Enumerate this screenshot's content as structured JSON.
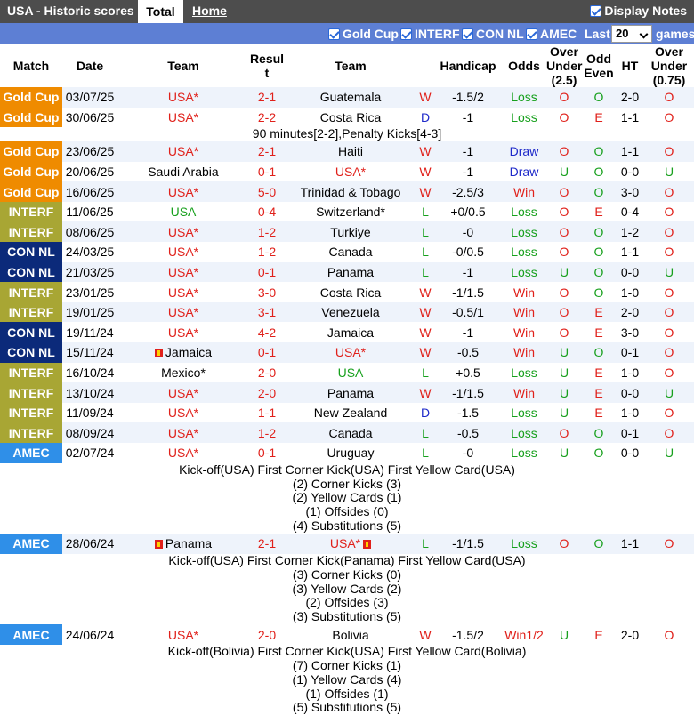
{
  "header": {
    "title": "USA - Historic scores",
    "tab_total": "Total",
    "tab_home": "Home",
    "display_notes": "Display Notes"
  },
  "filters": {
    "gold_cup": "Gold Cup",
    "interf": "INTERF",
    "con_nl": "CON NL",
    "amec": "AMEC",
    "last_label": "Last",
    "last_value": "20",
    "games_label": "games"
  },
  "columns": {
    "match": "Match",
    "date": "Date",
    "team": "Team",
    "result": "Resul t",
    "team2": "Team",
    "handicap": "Handicap",
    "odds": "Odds",
    "over_under": "Over Under (2.5)",
    "odd_even": "Odd Even",
    "ht": "HT",
    "over_under2": "Over Under (0.75)"
  },
  "rows": [
    {
      "comp": "Gold Cup",
      "date": "03/07/25",
      "home": "USA*",
      "score": "2-1",
      "away": "Guatemala",
      "res": "W",
      "hcp": "-1.5/2",
      "odds": "Loss",
      "ou": "O",
      "oe": "O",
      "ht": "2-0",
      "ou2": "O"
    },
    {
      "comp": "Gold Cup",
      "date": "30/06/25",
      "home": "USA*",
      "score": "2-2",
      "away": "Costa Rica",
      "res": "D",
      "hcp": "-1",
      "odds": "Loss",
      "ou": "O",
      "oe": "E",
      "ht": "1-1",
      "ou2": "O"
    },
    {
      "comp": "Gold Cup",
      "date": "23/06/25",
      "home": "USA*",
      "score": "2-1",
      "away": "Haiti",
      "res": "W",
      "hcp": "-1",
      "odds": "Draw",
      "ou": "O",
      "oe": "O",
      "ht": "1-1",
      "ou2": "O"
    },
    {
      "comp": "Gold Cup",
      "date": "20/06/25",
      "home": "Saudi Arabia",
      "score": "0-1",
      "away": "USA*",
      "res": "W",
      "hcp": "-1",
      "odds": "Draw",
      "ou": "U",
      "oe": "O",
      "ht": "0-0",
      "ou2": "U"
    },
    {
      "comp": "Gold Cup",
      "date": "16/06/25",
      "home": "USA*",
      "score": "5-0",
      "away": "Trinidad & Tobago",
      "res": "W",
      "hcp": "-2.5/3",
      "odds": "Win",
      "ou": "O",
      "oe": "O",
      "ht": "3-0",
      "ou2": "O"
    },
    {
      "comp": "INTERF",
      "date": "11/06/25",
      "home": "USA",
      "score": "0-4",
      "away": "Switzerland*",
      "res": "L",
      "hcp": "+0/0.5",
      "odds": "Loss",
      "ou": "O",
      "oe": "E",
      "ht": "0-4",
      "ou2": "O"
    },
    {
      "comp": "INTERF",
      "date": "08/06/25",
      "home": "USA*",
      "score": "1-2",
      "away": "Turkiye",
      "res": "L",
      "hcp": "-0",
      "odds": "Loss",
      "ou": "O",
      "oe": "O",
      "ht": "1-2",
      "ou2": "O"
    },
    {
      "comp": "CON NL",
      "date": "24/03/25",
      "home": "USA*",
      "score": "1-2",
      "away": "Canada",
      "res": "L",
      "hcp": "-0/0.5",
      "odds": "Loss",
      "ou": "O",
      "oe": "O",
      "ht": "1-1",
      "ou2": "O"
    },
    {
      "comp": "CON NL",
      "date": "21/03/25",
      "home": "USA*",
      "score": "0-1",
      "away": "Panama",
      "res": "L",
      "hcp": "-1",
      "odds": "Loss",
      "ou": "U",
      "oe": "O",
      "ht": "0-0",
      "ou2": "U"
    },
    {
      "comp": "INTERF",
      "date": "23/01/25",
      "home": "USA*",
      "score": "3-0",
      "away": "Costa Rica",
      "res": "W",
      "hcp": "-1/1.5",
      "odds": "Win",
      "ou": "O",
      "oe": "O",
      "ht": "1-0",
      "ou2": "O"
    },
    {
      "comp": "INTERF",
      "date": "19/01/25",
      "home": "USA*",
      "score": "3-1",
      "away": "Venezuela",
      "res": "W",
      "hcp": "-0.5/1",
      "odds": "Win",
      "ou": "O",
      "oe": "E",
      "ht": "2-0",
      "ou2": "O"
    },
    {
      "comp": "CON NL",
      "date": "19/11/24",
      "home": "USA*",
      "score": "4-2",
      "away": "Jamaica",
      "res": "W",
      "hcp": "-1",
      "odds": "Win",
      "ou": "O",
      "oe": "E",
      "ht": "3-0",
      "ou2": "O"
    },
    {
      "comp": "CON NL",
      "date": "15/11/24",
      "home": "Jamaica",
      "score": "0-1",
      "away": "USA*",
      "res": "W",
      "hcp": "-0.5",
      "odds": "Win",
      "ou": "U",
      "oe": "O",
      "ht": "0-1",
      "ou2": "O",
      "homeflag": true
    },
    {
      "comp": "INTERF",
      "date": "16/10/24",
      "home": "Mexico*",
      "score": "2-0",
      "away": "USA",
      "res": "L",
      "hcp": "+0.5",
      "odds": "Loss",
      "ou": "U",
      "oe": "E",
      "ht": "1-0",
      "ou2": "O"
    },
    {
      "comp": "INTERF",
      "date": "13/10/24",
      "home": "USA*",
      "score": "2-0",
      "away": "Panama",
      "res": "W",
      "hcp": "-1/1.5",
      "odds": "Win",
      "ou": "U",
      "oe": "E",
      "ht": "0-0",
      "ou2": "U"
    },
    {
      "comp": "INTERF",
      "date": "11/09/24",
      "home": "USA*",
      "score": "1-1",
      "away": "New Zealand",
      "res": "D",
      "hcp": "-1.5",
      "odds": "Loss",
      "ou": "U",
      "oe": "E",
      "ht": "1-0",
      "ou2": "O"
    },
    {
      "comp": "INTERF",
      "date": "08/09/24",
      "home": "USA*",
      "score": "1-2",
      "away": "Canada",
      "res": "L",
      "hcp": "-0.5",
      "odds": "Loss",
      "ou": "O",
      "oe": "O",
      "ht": "0-1",
      "ou2": "O"
    },
    {
      "comp": "AMEC",
      "date": "02/07/24",
      "home": "USA*",
      "score": "0-1",
      "away": "Uruguay",
      "res": "L",
      "hcp": "-0",
      "odds": "Loss",
      "ou": "U",
      "oe": "O",
      "ht": "0-0",
      "ou2": "U"
    },
    {
      "comp": "AMEC",
      "date": "28/06/24",
      "home": "Panama",
      "score": "2-1",
      "away": "USA*",
      "res": "L",
      "hcp": "-1/1.5",
      "odds": "Loss",
      "ou": "O",
      "oe": "O",
      "ht": "1-1",
      "ou2": "O",
      "homeflag": true,
      "awayflag": true
    },
    {
      "comp": "AMEC",
      "date": "24/06/24",
      "home": "USA*",
      "score": "2-0",
      "away": "Bolivia",
      "res": "W",
      "hcp": "-1.5/2",
      "odds": "Win1/2",
      "ou": "U",
      "oe": "E",
      "ht": "2-0",
      "ou2": "O"
    }
  ],
  "notes": {
    "1": [
      "90 minutes[2-2],Penalty Kicks[4-3]"
    ],
    "17": [
      "Kick-off(USA)  First Corner Kick(USA)  First Yellow Card(USA)",
      "(2) Corner Kicks (3)",
      "(2) Yellow Cards (1)",
      "(1) Offsides (0)",
      "(4) Substitutions (5)"
    ],
    "18": [
      "Kick-off(USA)  First Corner Kick(Panama)  First Yellow Card(USA)",
      "(3) Corner Kicks (0)",
      "(3) Yellow Cards (2)",
      "(2) Offsides (3)",
      "(3) Substitutions (5)"
    ],
    "19": [
      "Kick-off(Bolivia)  First Corner Kick(USA)  First Yellow Card(Bolivia)",
      "(7) Corner Kicks (1)",
      "(1) Yellow Cards (4)",
      "(1) Offsides (1)",
      "(5) Substitutions (5)"
    ]
  },
  "colors": {
    "gold_cup": "#ef8b00",
    "interf": "#a8a634",
    "con_nl": "#0b2a7a",
    "amec": "#2f8fe8",
    "win": "#e0201a",
    "draw": "#1d28c9",
    "loss": "#17a01d",
    "header_bg": "#4d4d4d",
    "filter_bg": "#5d7fd4"
  }
}
